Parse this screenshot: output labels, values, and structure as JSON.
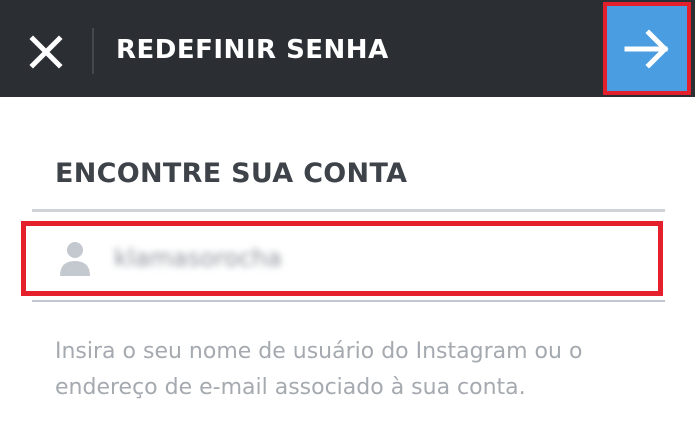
{
  "header": {
    "title": "REDEFINIR SENHA",
    "close_icon": "close-icon",
    "next_icon": "arrow-right-icon",
    "background_color": "#2b2f34",
    "next_button_color": "#4a9de0"
  },
  "form": {
    "section_title": "ENCONTRE SUA CONTA",
    "username_icon": "user-icon",
    "username_value": "klamasorocha",
    "help_text": "Insira o seu nome de usuário do Instagram ou o endereço de e-mail associado à sua conta."
  },
  "highlight_color": "#e3202b"
}
